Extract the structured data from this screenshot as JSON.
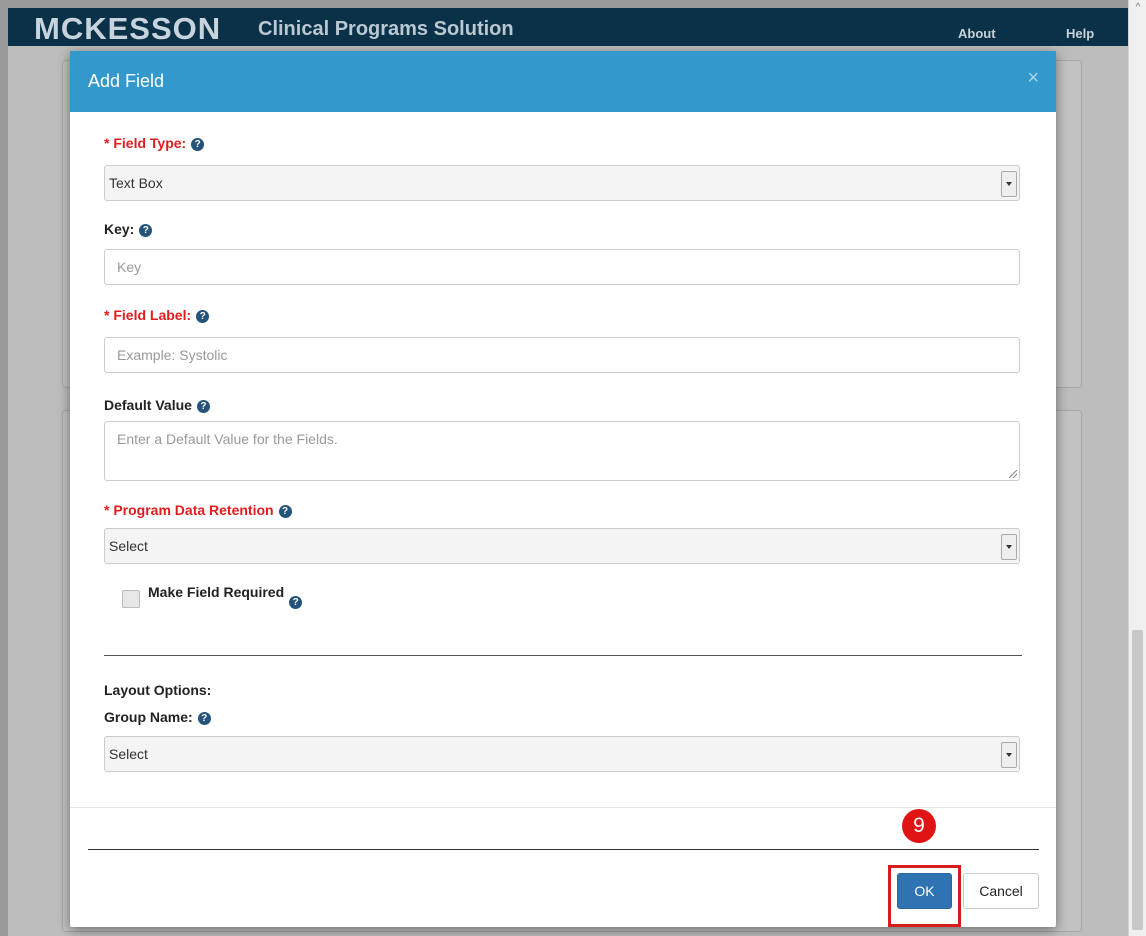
{
  "header": {
    "logo": "MCKESSON",
    "app_title": "Clinical Programs Solution",
    "nav": {
      "about": "About",
      "help": "Help"
    }
  },
  "modal": {
    "title": "Add Field",
    "close_icon": "close-icon",
    "field_type": {
      "label": "* Field Type:",
      "value": "Text Box"
    },
    "key": {
      "label": "Key:",
      "placeholder": "Key"
    },
    "field_label": {
      "label": "* Field Label:",
      "placeholder": "Example: Systolic"
    },
    "default_value": {
      "label": "Default Value",
      "placeholder": "Enter a Default Value for the Fields."
    },
    "retention": {
      "label": "* Program Data Retention",
      "value": "Select"
    },
    "required": {
      "label": "Make Field Required",
      "checked": false
    },
    "layout": {
      "title": "Layout Options:",
      "group_label": "Group Name:",
      "group_value": "Select"
    },
    "buttons": {
      "ok": "OK",
      "cancel": "Cancel"
    }
  },
  "annotation": {
    "step": "9",
    "color": "#e01414"
  },
  "colors": {
    "header_bg": "#0a3148",
    "modal_header": "#3399cc",
    "required": "#e21c1c",
    "ok": "#2f73b3"
  }
}
